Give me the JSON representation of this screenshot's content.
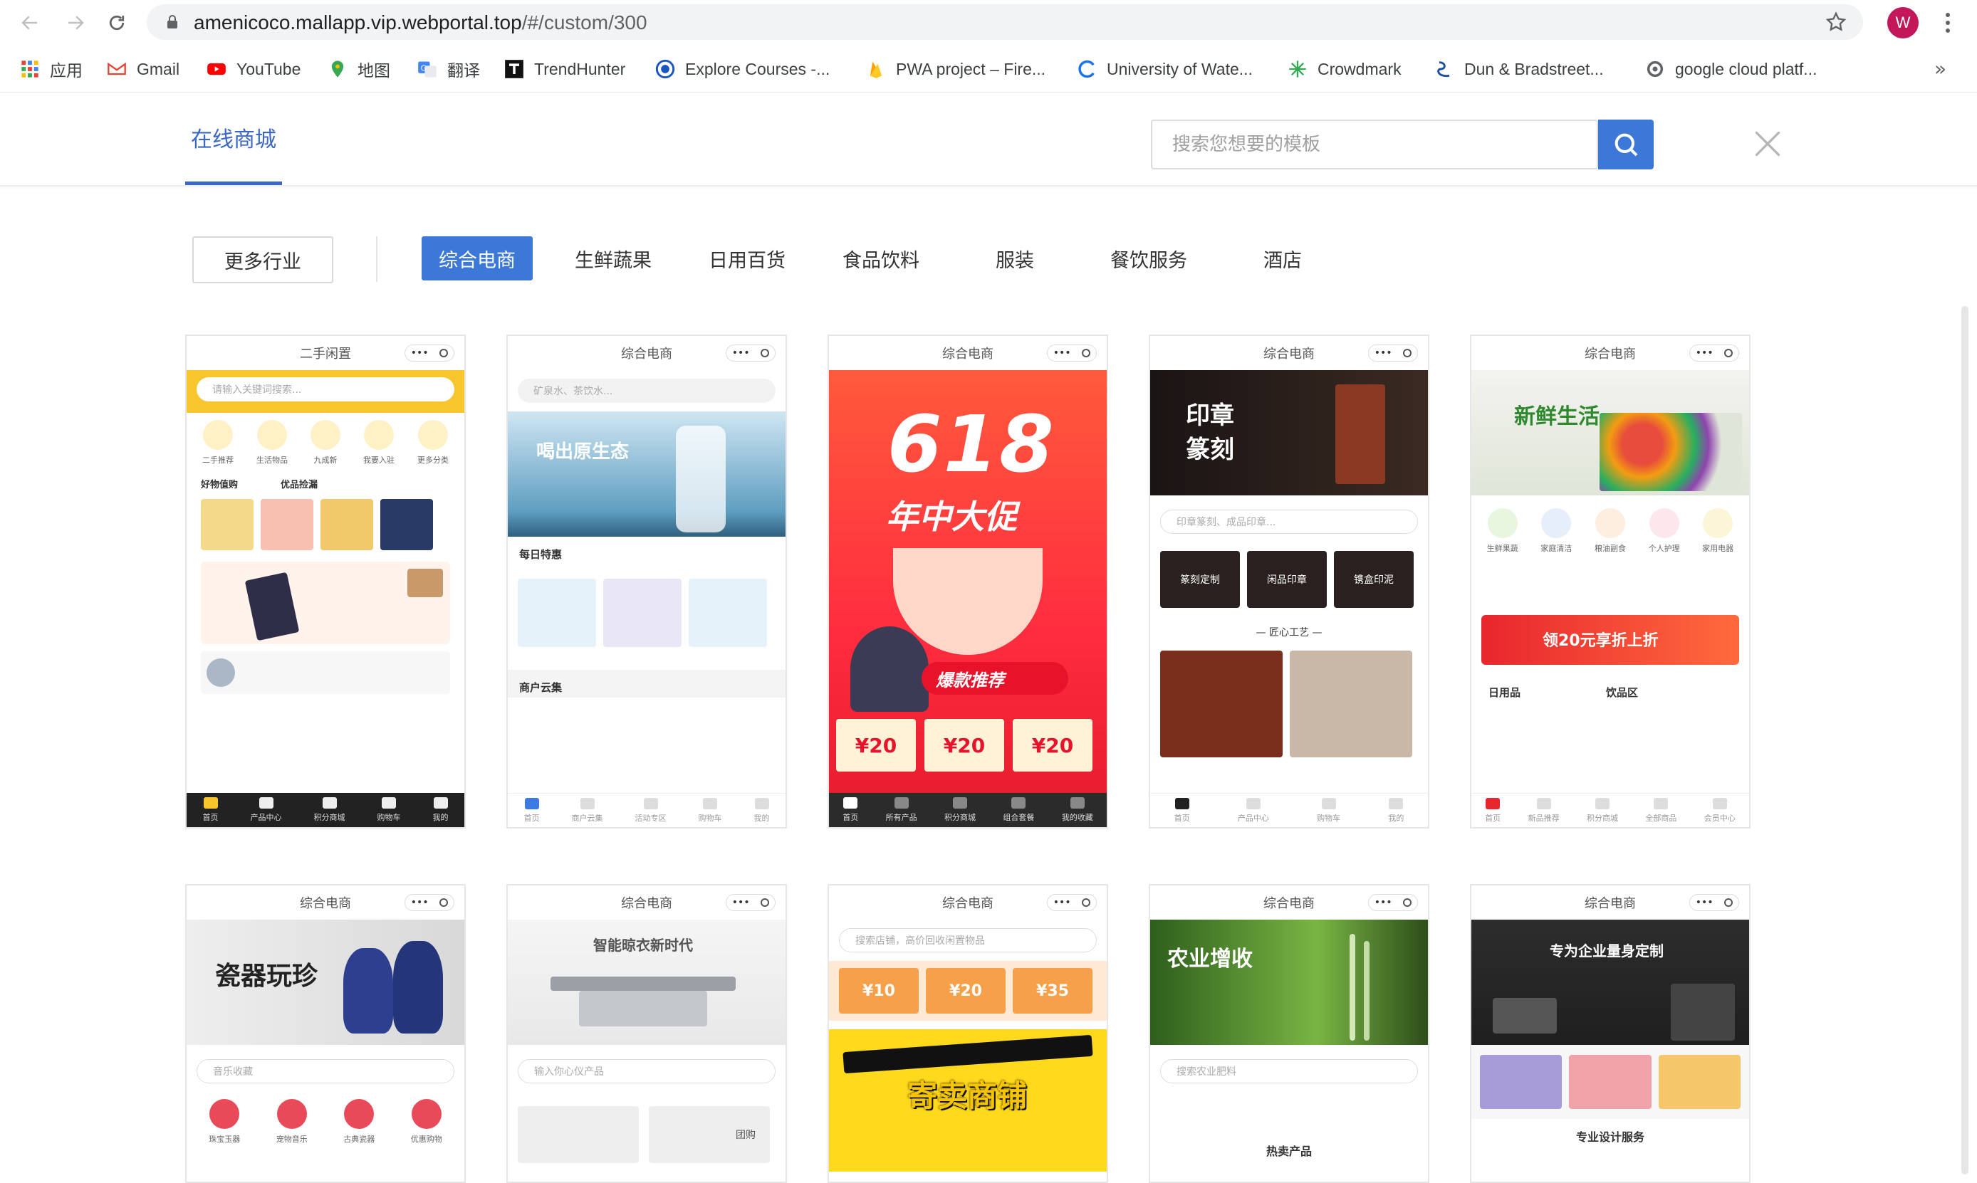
{
  "browser": {
    "url_main": "amenicoco.mallapp.vip.webportal.top",
    "url_path": "/#/custom/300",
    "profile_initial": "W",
    "bookmarks": [
      {
        "label": "应用",
        "icon": "apps-grid-icon"
      },
      {
        "label": "Gmail",
        "icon": "gmail-icon"
      },
      {
        "label": "YouTube",
        "icon": "youtube-icon"
      },
      {
        "label": "地图",
        "icon": "maps-pin-icon"
      },
      {
        "label": "翻译",
        "icon": "translate-icon"
      },
      {
        "label": "TrendHunter",
        "icon": "trendhunter-icon"
      },
      {
        "label": "Explore Courses -...",
        "icon": "courses-icon"
      },
      {
        "label": "PWA project – Fire...",
        "icon": "firebase-icon"
      },
      {
        "label": "University of Wate...",
        "icon": "waterloo-icon"
      },
      {
        "label": "Crowdmark",
        "icon": "crowdmark-icon"
      },
      {
        "label": "Dun & Bradstreet...",
        "icon": "dnb-icon"
      },
      {
        "label": "google cloud platf...",
        "icon": "gcp-icon"
      }
    ],
    "more_label": "»"
  },
  "header": {
    "tab_label": "在线商城",
    "search_placeholder": "搜索您想要的模板"
  },
  "filters": {
    "more_label": "更多行业",
    "categories": [
      "综合电商",
      "生鲜蔬果",
      "日用百货",
      "食品饮料",
      "服装",
      "餐饮服务",
      "酒店"
    ],
    "active": "综合电商"
  },
  "cards": [
    {
      "title": "二手闲置",
      "banner": "",
      "search": "请输入关键词搜索...",
      "icons": [
        "二手推荐",
        "生活物品",
        "九成新",
        "我要入驻",
        "更多分类"
      ],
      "section1": "好物值购",
      "section2": "优品捡漏",
      "tabs": [
        "首页",
        "产品中心",
        "积分商城",
        "购物车",
        "我的"
      ]
    },
    {
      "title": "综合电商",
      "banner": "喝出原生态",
      "search": "矿泉水、茶饮水...",
      "section1": "每日特惠",
      "section2": "商户云集",
      "tabs": [
        "首页",
        "商户云集",
        "活动专区",
        "购物车",
        "我的"
      ]
    },
    {
      "title": "综合电商",
      "banner": "618",
      "banner_sub": "年中大促",
      "badge": "爆款推荐",
      "coupons": [
        "¥20",
        "¥20",
        "¥20"
      ],
      "tabs": [
        "首页",
        "所有产品",
        "积分商城",
        "组合套餐",
        "我的收藏"
      ]
    },
    {
      "title": "综合电商",
      "banner": "印章篆刻",
      "search": "印章篆刻、成品印章...",
      "chips": [
        "篆刻定制",
        "闲品印章",
        "镌盒印泥"
      ],
      "section1": "— 匠心工艺 —",
      "tabs": [
        "首页",
        "产品中心",
        "购物车",
        "我的"
      ]
    },
    {
      "title": "综合电商",
      "banner": "新鲜生活",
      "icons": [
        "生鲜果蔬",
        "家庭清洁",
        "粮油副食",
        "个人护理",
        "家用电器"
      ],
      "promo": "领20元享折上折",
      "section1": "日用品",
      "section2": "饮品区",
      "tabs": [
        "首页",
        "新品推荐",
        "积分商城",
        "全部商品",
        "会员中心"
      ]
    },
    {
      "title": "综合电商",
      "banner": "瓷器玩珍",
      "search": "音乐收藏",
      "icons": [
        "珠宝玉器",
        "宠物音乐",
        "古典瓷器",
        "优惠购物"
      ]
    },
    {
      "title": "综合电商",
      "banner": "智能晾衣新时代",
      "search": "输入你心仪产品",
      "section1": "团购"
    },
    {
      "title": "综合电商",
      "search": "搜索店铺，高价回收闲置物品",
      "coupons": [
        "¥10",
        "¥20",
        "¥35"
      ],
      "banner": "寄卖商铺"
    },
    {
      "title": "综合电商",
      "banner": "农业增收",
      "search": "搜索农业肥料",
      "section1": "热卖产品"
    },
    {
      "title": "综合电商",
      "banner": "专为企业量身定制",
      "section1": "专业设计服务"
    }
  ]
}
